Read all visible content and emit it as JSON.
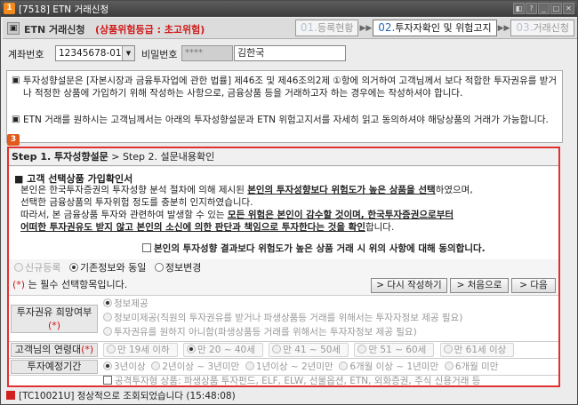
{
  "window": {
    "app_icon": "1",
    "title": "[7518] ETN 거래신청"
  },
  "header": {
    "name": "ETN 거래신청",
    "risk": "(상품위험등급 : 초고위험)"
  },
  "steps": [
    {
      "num": "01.",
      "label": "등록현황"
    },
    {
      "num": "02.",
      "label": "투자자확인 및 위험고지"
    },
    {
      "num": "03.",
      "label": "거래신청"
    }
  ],
  "account": {
    "acct_label": "계좌번호",
    "acct_value": "12345678-01",
    "pw_label": "비밀번호",
    "pw_value": "****",
    "name_value": "김한국"
  },
  "info": {
    "para1": "투자성향설문은 [자본시장과 금융투자업에 관한 법률] 제46조 및 제46조의2제 ①항에 의거하여 고객님께서 보다 적합한 투자권유를 받거나 적정한 상품에 가입하기 위해 작성하는 사항으로, 금융상품 등을 거래하고자 하는 경우에는 작성하셔야 합니다.",
    "para2": "ETN 거래를 원하시는 고객님께서는 아래의 투자성향설문과 ETN 위험고지서를 자세히 읽고 동의하셔야 해당상품의 거래가 가능합니다."
  },
  "section_num": "3",
  "step_header": {
    "step1": "Step 1. 투자성향설문",
    "sep": " > ",
    "step2": "Step 2. 설문내용확인"
  },
  "consent": {
    "title": "■ 고객 선택상품 가입확인서",
    "l1a": "본인은 한국투자증권의 투자성향 분석 절차에 의해 제시된 ",
    "l1b": "본인의 투자성향보다 위험도가 높은 상품을 선택",
    "l1c": "하였으며,",
    "l2": "선택한 금융상품의 투자위험 정도를 충분히 인지하였습니다.",
    "l3a": "따라서, 본 금융상품 투자와 관련하여 발생할 수 있는 ",
    "l3b": "모든 위험은 본인이 감수할 것이며, 한국투자증권으로부터",
    "l4a": "어떠한 투자권유도 받지 않고 본인의 소신에 의한 판단과 책임으로 투자한다는 것을 확인",
    "l4b": "합니다.",
    "agree": "본인의 투자성향 결과보다 위험도가 높은 상품 거래 시 위의 사항에 대해 동의합니다."
  },
  "radios": {
    "new": "신규등록",
    "existing": "기존정보와 동일",
    "change": "정보변경"
  },
  "required": {
    "star": "(*)",
    "text": " 는 필수 선택항목입니다.",
    "rewrite": "> 다시 작성하기",
    "first": "> 처음으로",
    "next": "> 다음"
  },
  "q_intent": {
    "label": "투자권유 희망여부",
    "star": "(*)",
    "o1": "정보제공",
    "o2": "정보미제공(직원의 투자권유를 받거나 파생상품등 거래를 위해서는 투자자정보 제공 필요)",
    "o3": "투자권유를 원하지 아니함(파생상품등 거래를 위해서는 투자자정보 제공 필요)"
  },
  "q_age": {
    "label": "고객님의 연령대",
    "star": "(*)",
    "opts": [
      "만 19세 이하",
      "만 20 ~ 40세",
      "만 41 ~ 50세",
      "만 51 ~ 60세",
      "만 61세 이상"
    ]
  },
  "q_period": {
    "label": "투자예정기간",
    "opts": [
      "3년이상",
      "2년이상 ~ 3년미만",
      "1년이상 ~ 2년미만",
      "6개월 이상 ~ 1년미만",
      "6개월 미만"
    ]
  },
  "q_partial": "공격투자형 상품: 파생상품 투자펀드, ELF, ELW, 선물옵션, ETN, 외화증권, 주식 신용거래 등",
  "status": {
    "text": "[TC10021U] 정상적으로 조회되었습니다 (15:48:08)"
  }
}
